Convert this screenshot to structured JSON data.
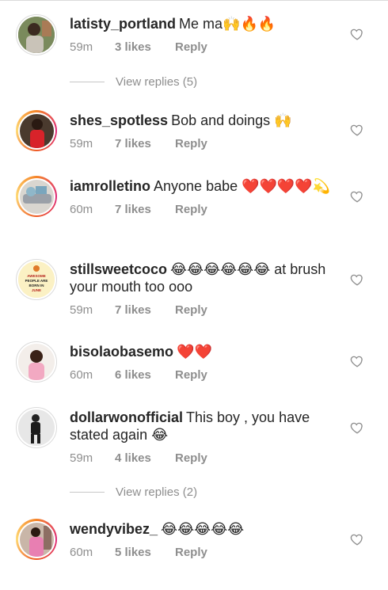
{
  "comments": [
    {
      "username": "latisty_portland",
      "text": "Me ma🙌🔥🔥",
      "time": "59m",
      "likes": "3 likes",
      "reply": "Reply"
    },
    {
      "username": "shes_spotless",
      "text": "Bob and doings 🙌",
      "time": "59m",
      "likes": "7 likes",
      "reply": "Reply"
    },
    {
      "username": "iamrolletino",
      "text": "Anyone babe ❤️❤️❤️❤️💫",
      "time": "60m",
      "likes": "7 likes",
      "reply": "Reply"
    },
    {
      "username": "stillsweetcoco",
      "text": "😂😂😂😂😂😂 at brush your mouth too ooo",
      "time": "59m",
      "likes": "7 likes",
      "reply": "Reply"
    },
    {
      "username": "bisolaobasemo",
      "text": "❤️❤️",
      "time": "60m",
      "likes": "6 likes",
      "reply": "Reply"
    },
    {
      "username": "dollarwonofficial",
      "text": "This boy , you have stated again 😂",
      "time": "59m",
      "likes": "4 likes",
      "reply": "Reply"
    },
    {
      "username": "wendyvibez_",
      "text": "😂😂😂😂😂",
      "time": "60m",
      "likes": "5 likes",
      "reply": "Reply"
    }
  ],
  "view_replies": [
    "View replies (5)",
    "View replies (2)"
  ],
  "avatar_badge_text": "AWESOME PEOPLE ARE BORN IN JUNE",
  "colors": {
    "heart_red": "#e0102b",
    "meta_gray": "#8e8e8e",
    "text": "#262626"
  },
  "icons": {
    "like": "heart-outline-icon"
  }
}
